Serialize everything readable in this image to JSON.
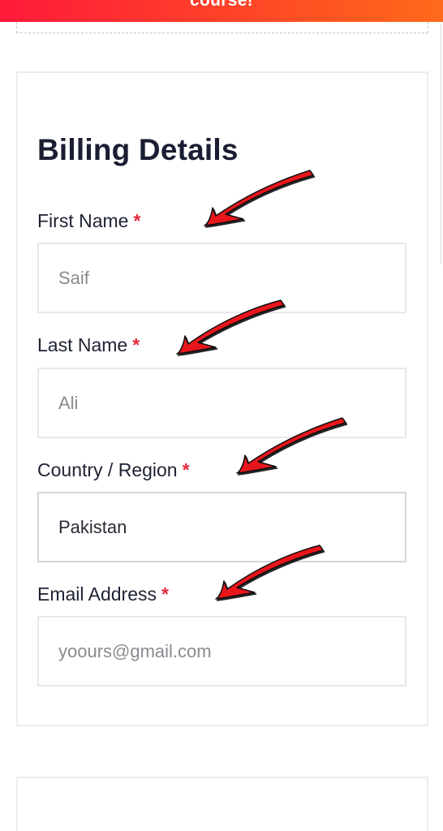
{
  "banner": {
    "text": "course!"
  },
  "billing": {
    "title": "Billing Details",
    "required_marker": "*",
    "fields": [
      {
        "label": "First Name",
        "placeholder": "Saif"
      },
      {
        "label": "Last Name",
        "placeholder": "Ali"
      },
      {
        "label": "Country / Region",
        "value": "Pakistan"
      },
      {
        "label": "Email Address",
        "placeholder": "yoours@gmail.com"
      }
    ]
  },
  "colors": {
    "banner_gradient_start": "#ff1a3a",
    "banner_gradient_end": "#ff6a1a",
    "required_star": "#e5283b",
    "annotation_arrow": "#e8141e"
  },
  "annotations": {
    "arrow_icon": "red-hand-drawn-arrow-icon"
  }
}
